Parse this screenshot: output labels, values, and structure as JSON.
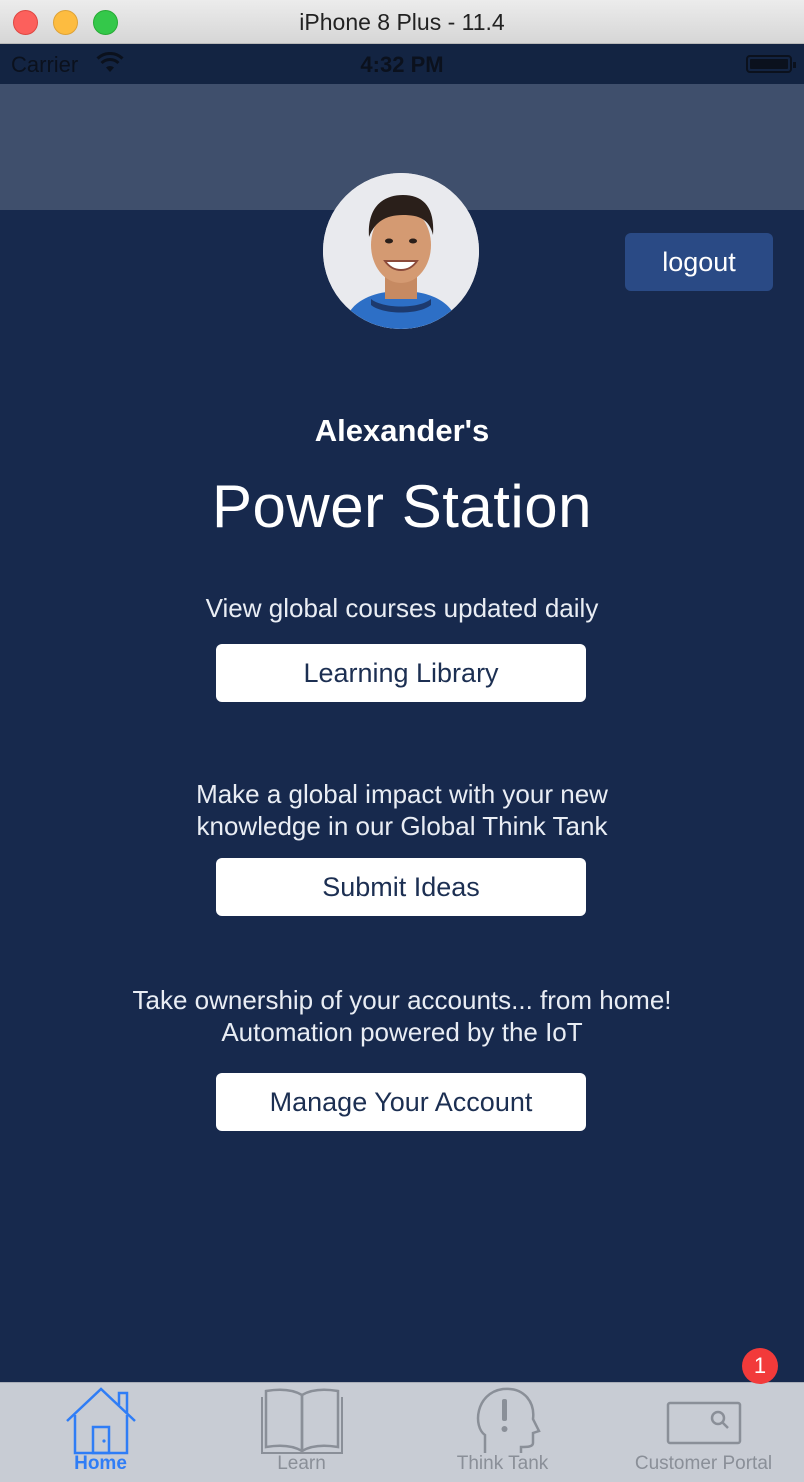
{
  "window": {
    "title": "iPhone 8 Plus - 11.4"
  },
  "statusbar": {
    "carrier": "Carrier",
    "time": "4:32 PM"
  },
  "header": {
    "logout_label": "logout"
  },
  "hero": {
    "owner": "Alexander's",
    "title": "Power Station"
  },
  "sections": [
    {
      "text_lines": [
        "View global courses updated daily"
      ],
      "button": "Learning Library"
    },
    {
      "text_lines": [
        "Make a global impact with your new",
        "knowledge in our Global Think Tank"
      ],
      "button": "Submit Ideas"
    },
    {
      "text_lines": [
        "Take ownership of your accounts... from home!",
        "Automation powered by the IoT"
      ],
      "button": "Manage Your Account"
    }
  ],
  "tabbar": {
    "tabs": [
      {
        "label": "Home",
        "icon": "house-icon",
        "active": true
      },
      {
        "label": "Learn",
        "icon": "book-icon",
        "active": false
      },
      {
        "label": "Think Tank",
        "icon": "head-exclamation-icon",
        "active": false
      },
      {
        "label": "Customer Portal",
        "icon": "portal-search-icon",
        "active": false
      }
    ],
    "badge": "1"
  },
  "colors": {
    "background": "#17294d",
    "header_band": "#3f4f6c",
    "logout_button": "#2a4a85",
    "tab_active": "#2f7df6",
    "tab_inactive": "#8a8f98",
    "badge": "#f23a3a"
  }
}
